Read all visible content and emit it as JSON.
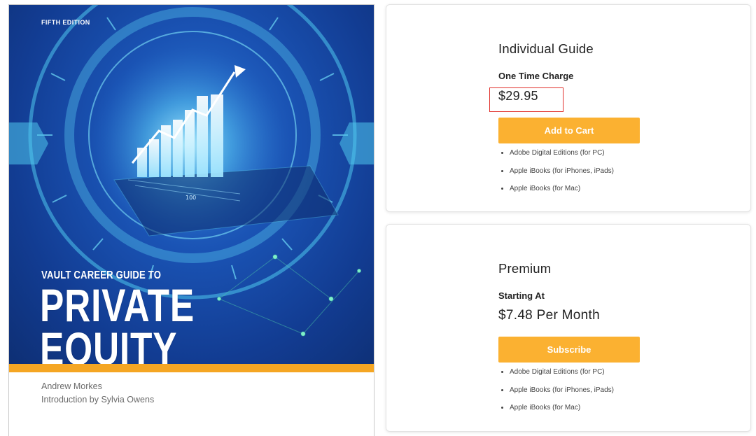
{
  "book": {
    "edition": "FIFTH EDITION",
    "series": "VAULT CAREER GUIDE TO",
    "title_line_1": "PRIVATE",
    "title_line_2": "EQUITY",
    "author": "Andrew Morkes",
    "introduction": "Introduction by Sylvia Owens",
    "chart_label": "100"
  },
  "plans": [
    {
      "title": "Individual Guide",
      "subtitle": "One Time Charge",
      "price": "$29.95",
      "price_highlighted": true,
      "button_label": "Add to Cart",
      "formats": [
        "Adobe Digital Editions (for PC)",
        "Apple iBooks (for iPhones, iPads)",
        "Apple iBooks (for Mac)"
      ]
    },
    {
      "title": "Premium",
      "subtitle": "Starting At",
      "price": "$7.48 Per Month",
      "button_label": "Subscribe",
      "formats": [
        "Adobe Digital Editions (for PC)",
        "Apple iBooks (for iPhones, iPads)",
        "Apple iBooks (for Mac)"
      ]
    }
  ],
  "colors": {
    "button": "#fbb131",
    "cover_band": "#f5a623",
    "highlight_box": "#e0312c",
    "cover_blue": "#1a53b4"
  }
}
